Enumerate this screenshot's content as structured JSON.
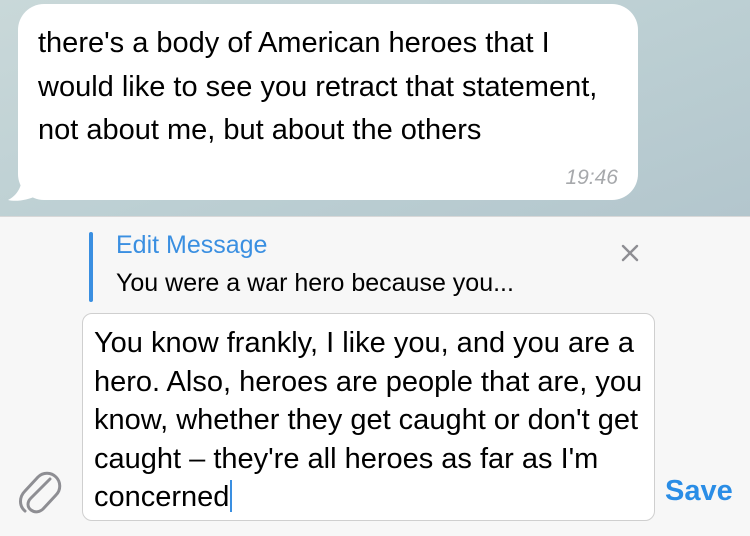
{
  "chat": {
    "message": {
      "text": "there's a body of American heroes that I would like to see you retract that statement, not about me, but about the others",
      "time": "19:46"
    }
  },
  "composer": {
    "edit_title": "Edit Message",
    "edit_preview": "You were a war hero because you...",
    "input_value": "You know frankly, I like you, and you are a hero. Also, heroes are people that are, you know, whether they get caught or don't get caught – they're all heroes as far as I'm concerned",
    "save_label": "Save",
    "icons": {
      "close": "close-icon",
      "attach": "paperclip-icon"
    }
  },
  "colors": {
    "accent": "#3a8fe1",
    "save": "#2a8de6",
    "timestamp": "#a7a9ac",
    "panel_background": "#f7f7f7",
    "chat_background": "#c3d4d7"
  }
}
